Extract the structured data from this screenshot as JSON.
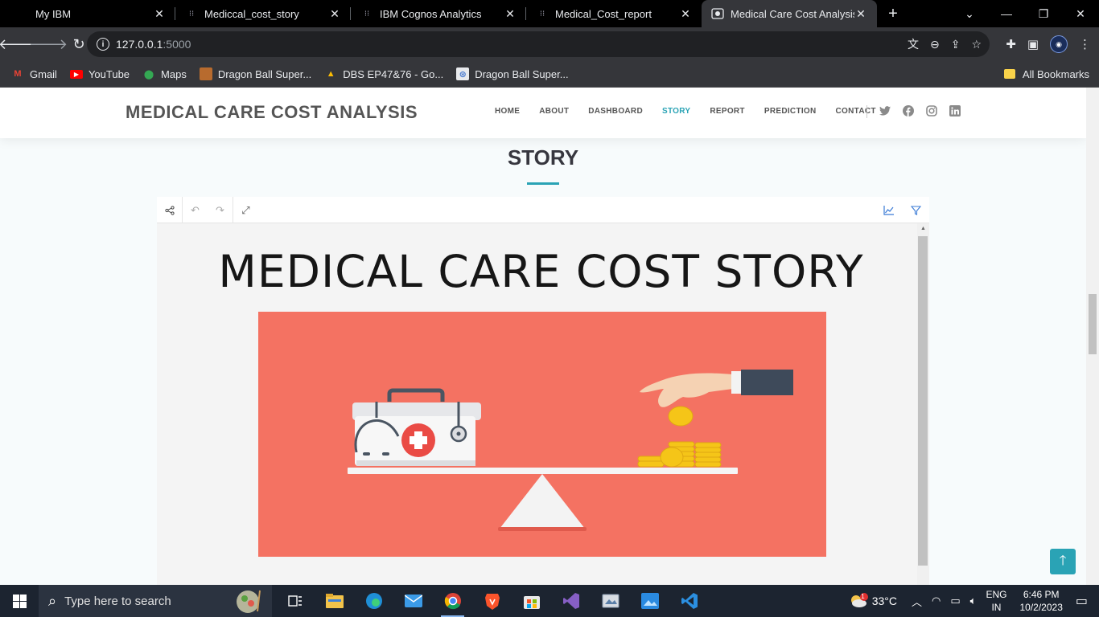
{
  "browser": {
    "tabs": [
      {
        "title": "My IBM",
        "icon": "ibm-icon"
      },
      {
        "title": "Mediccal_cost_story",
        "icon": "cognos-icon"
      },
      {
        "title": "IBM Cognos Analytics",
        "icon": "cognos-icon"
      },
      {
        "title": "Medical_Cost_report",
        "icon": "cognos-icon"
      },
      {
        "title": "Medical Care Cost Analysis",
        "icon": "site-icon",
        "active": true
      }
    ],
    "url_host": "127.0.0.1",
    "url_port": ":5000",
    "bookmarks": [
      {
        "label": "Gmail",
        "icon": "gmail-icon"
      },
      {
        "label": "YouTube",
        "icon": "youtube-icon"
      },
      {
        "label": "Maps",
        "icon": "maps-icon"
      },
      {
        "label": "Dragon Ball Super...",
        "icon": "dbs-icon"
      },
      {
        "label": "DBS EP47&76 - Go...",
        "icon": "drive-icon"
      },
      {
        "label": "Dragon Ball Super...",
        "icon": "dbs2-icon"
      }
    ],
    "all_bookmarks": "All Bookmarks"
  },
  "site": {
    "logo": "MEDICAL CARE COST ANALYSIS",
    "nav": [
      "HOME",
      "ABOUT",
      "DASHBOARD",
      "STORY",
      "REPORT",
      "PREDICTION",
      "CONTACT"
    ],
    "active_nav": "STORY",
    "section_title": "STORY",
    "accent_color": "#2aa3b5"
  },
  "embed": {
    "story_heading": "MEDICAL CARE COST STORY",
    "illustration_bg": "#f47262"
  },
  "taskbar": {
    "search_placeholder": "Type here to search",
    "temperature": "33°C",
    "weather_badge": "1",
    "lang_top": "ENG",
    "lang_bottom": "IN",
    "time": "6:46 PM",
    "date": "10/2/2023"
  }
}
